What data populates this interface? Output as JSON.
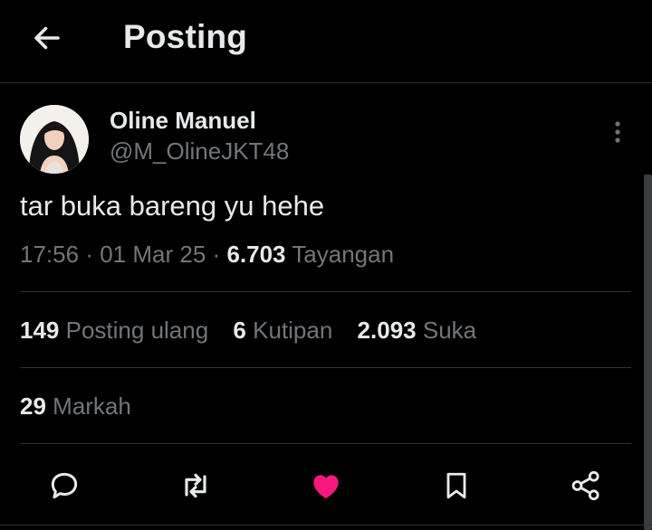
{
  "header": {
    "title": "Posting",
    "back_icon": "arrow-left-icon"
  },
  "post": {
    "author": {
      "name": "Oline Manuel",
      "handle": "@M_OlineJKT48",
      "avatar": "avatar"
    },
    "text": "tar buka bareng yu hehe",
    "time": "17:56",
    "date": "01 Mar 25",
    "separator": "·",
    "views_count": "6.703",
    "views_label": "Tayangan"
  },
  "stats": {
    "reposts": {
      "count": "149",
      "label": "Posting ulang"
    },
    "quotes": {
      "count": "6",
      "label": "Kutipan"
    },
    "likes": {
      "count": "2.093",
      "label": "Suka"
    },
    "bookmarks": {
      "count": "29",
      "label": "Markah"
    }
  },
  "actions": [
    {
      "icon": "reply-icon"
    },
    {
      "icon": "repost-icon"
    },
    {
      "icon": "like-icon",
      "active": true
    },
    {
      "icon": "bookmark-icon"
    },
    {
      "icon": "share-icon"
    }
  ],
  "colors": {
    "background": "#000000",
    "text": "#e7e9ea",
    "secondary": "#71767b",
    "divider": "#2f3336",
    "like": "#f91880"
  }
}
